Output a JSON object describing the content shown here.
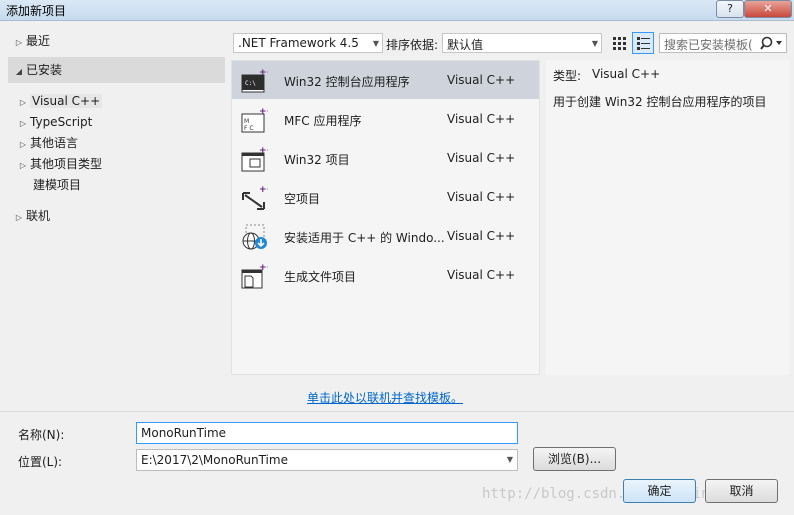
{
  "window": {
    "title": "添加新项目",
    "help": "?",
    "close": "✕"
  },
  "tree": {
    "recent": "最近",
    "installed": "已安装",
    "visual_cpp": "Visual C++",
    "typescript": "TypeScript",
    "other_languages": "其他语言",
    "other_project_types": "其他项目类型",
    "modeling_projects": "建模项目",
    "online": "联机"
  },
  "toolbar": {
    "framework": ".NET Framework 4.5",
    "sort_label": "排序依据:",
    "sort_value": "默认值",
    "search_placeholder": "搜索已安装模板("
  },
  "templates": [
    {
      "name": "Win32 控制台应用程序",
      "lang": "Visual C++",
      "icon": "console-app-icon"
    },
    {
      "name": "MFC 应用程序",
      "lang": "Visual C++",
      "icon": "mfc-app-icon"
    },
    {
      "name": "Win32 项目",
      "lang": "Visual C++",
      "icon": "win32-project-icon"
    },
    {
      "name": "空项目",
      "lang": "Visual C++",
      "icon": "empty-project-icon"
    },
    {
      "name": "安装适用于 C++ 的 Windo...",
      "lang": "Visual C++",
      "icon": "install-windows-sdk-icon"
    },
    {
      "name": "生成文件项目",
      "lang": "Visual C++",
      "icon": "makefile-project-icon"
    }
  ],
  "details": {
    "type_label": "类型:",
    "type_value": "Visual C++",
    "description": "用于创建 Win32 控制台应用程序的项目"
  },
  "online_link": "单击此处以联机并查找模板。",
  "form": {
    "name_label": "名称(N):",
    "name_value": "MonoRunTime",
    "location_label": "位置(L):",
    "location_value": "E:\\2017\\2\\MonoRunTime",
    "browse": "浏览(B)..."
  },
  "buttons": {
    "ok": "确定",
    "cancel": "取消"
  },
  "watermark": "http://blog.csdn.net/zouxin1678"
}
